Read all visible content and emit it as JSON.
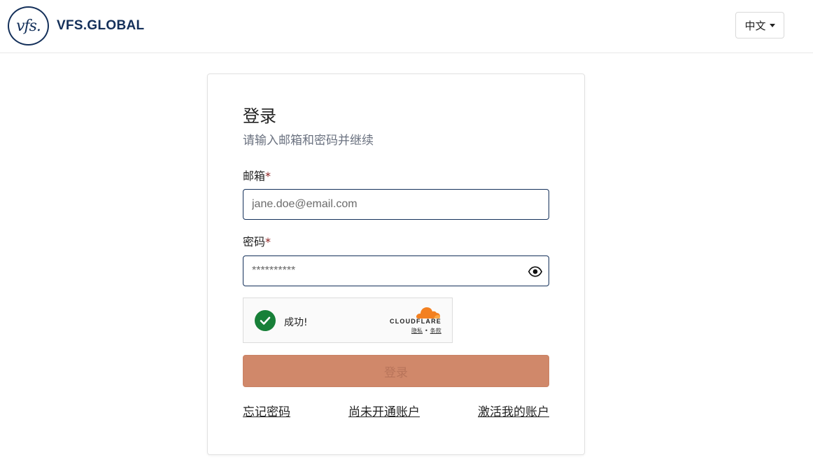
{
  "header": {
    "logo_mark": "vfs.",
    "logo_text": "VFS.GLOBAL",
    "language": "中文"
  },
  "login": {
    "title": "登录",
    "subtitle": "请输入邮箱和密码并继续",
    "email_label": "邮箱",
    "email_placeholder": "jane.doe@email.com",
    "password_label": "密码",
    "password_value": "**********",
    "required_mark": "*",
    "captcha": {
      "status": "成功!",
      "brand": "CLOUDFLARE",
      "privacy": "隐私",
      "separator": "•",
      "terms": "条款"
    },
    "submit_label": "登录",
    "links": {
      "forgot_password": "忘记密码",
      "no_account": "尚未开通账户",
      "activate_account": "激活我的账户"
    }
  },
  "colors": {
    "brand_navy": "#14305a",
    "submit_bg": "#d0886a",
    "success_green": "#188038",
    "cloudflare_orange": "#f38020"
  },
  "icons": {
    "password_toggle": "eye-icon",
    "captcha_status": "check-circle-icon",
    "language_dropdown": "caret-down-icon",
    "cloudflare": "cloud-icon"
  }
}
